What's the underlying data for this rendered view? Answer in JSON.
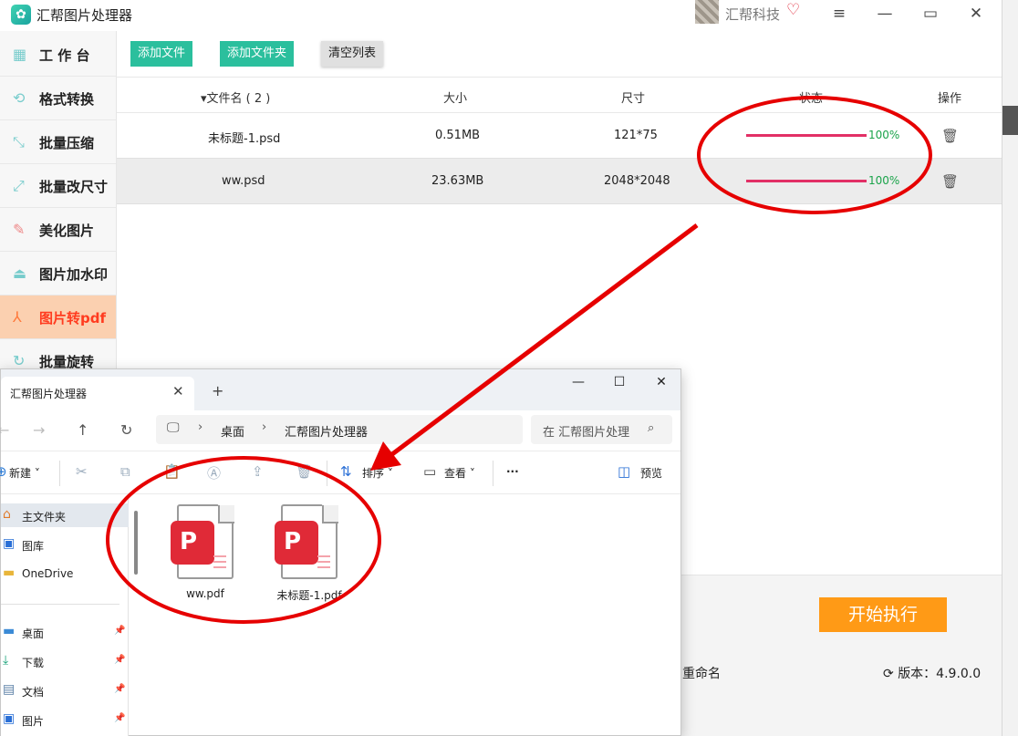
{
  "app": {
    "title": "汇帮图片处理器",
    "brand": "汇帮科技",
    "sidebar": [
      {
        "label": "工 作 台",
        "icon": "grid-icon"
      },
      {
        "label": "格式转换",
        "icon": "convert-icon"
      },
      {
        "label": "批量压缩",
        "icon": "compress-icon"
      },
      {
        "label": "批量改尺寸",
        "icon": "resize-icon"
      },
      {
        "label": "美化图片",
        "icon": "beautify-icon"
      },
      {
        "label": "图片加水印",
        "icon": "watermark-icon"
      },
      {
        "label": "图片转pdf",
        "icon": "pdf-icon"
      },
      {
        "label": "批量旋转",
        "icon": "rotate-icon"
      }
    ],
    "toolbar": {
      "add_file": "添加文件",
      "add_folder": "添加文件夹",
      "clear_list": "清空列表"
    },
    "columns": {
      "name": "▾文件名 ( 2 )",
      "size": "大小",
      "dimensions": "尺寸",
      "status": "状态",
      "actions": "操作"
    },
    "files": [
      {
        "name": "未标题-1.psd",
        "size": "0.51MB",
        "dimensions": "121*75",
        "progress": 1.0,
        "progress_text": "100%"
      },
      {
        "name": "ww.psd",
        "size": "23.63MB",
        "dimensions": "2048*2048",
        "progress": 1.0,
        "progress_text": "100%"
      }
    ],
    "start_button": "开始执行",
    "rename_fragment": "重命名",
    "version": "版本：4.9.0.0"
  },
  "explorer": {
    "tab_title": "汇帮图片处理器",
    "breadcrumb": [
      "桌面",
      "汇帮图片处理器"
    ],
    "search_placeholder": "在 汇帮图片处理",
    "commands": {
      "new": "新建",
      "sort": "排序",
      "view": "查看",
      "more": "···",
      "preview": "预览"
    },
    "nav": [
      {
        "label": "主文件夹",
        "icon": "home-icon",
        "color": "#e07a2a"
      },
      {
        "label": "图库",
        "icon": "gallery-icon",
        "color": "#2a6fd6"
      },
      {
        "label": "OneDrive",
        "icon": "folder-icon",
        "color": "#e8b53a"
      }
    ],
    "pinned": [
      {
        "label": "桌面",
        "icon": "desktop-icon",
        "color": "#3a8ad6"
      },
      {
        "label": "下载",
        "icon": "download-icon",
        "color": "#1aa37a"
      },
      {
        "label": "文档",
        "icon": "document-icon",
        "color": "#5a7fa6"
      },
      {
        "label": "图片",
        "icon": "picture-icon",
        "color": "#2a6fd6"
      }
    ],
    "files": [
      {
        "name": "ww.pdf",
        "icon": "pdf-file-icon"
      },
      {
        "name": "未标题-1.pdf",
        "icon": "pdf-file-icon"
      }
    ]
  },
  "colors": {
    "accent": "#2bbf9d",
    "start": "#ff9a16",
    "progress": "#e23066",
    "annotation": "#e60000"
  }
}
